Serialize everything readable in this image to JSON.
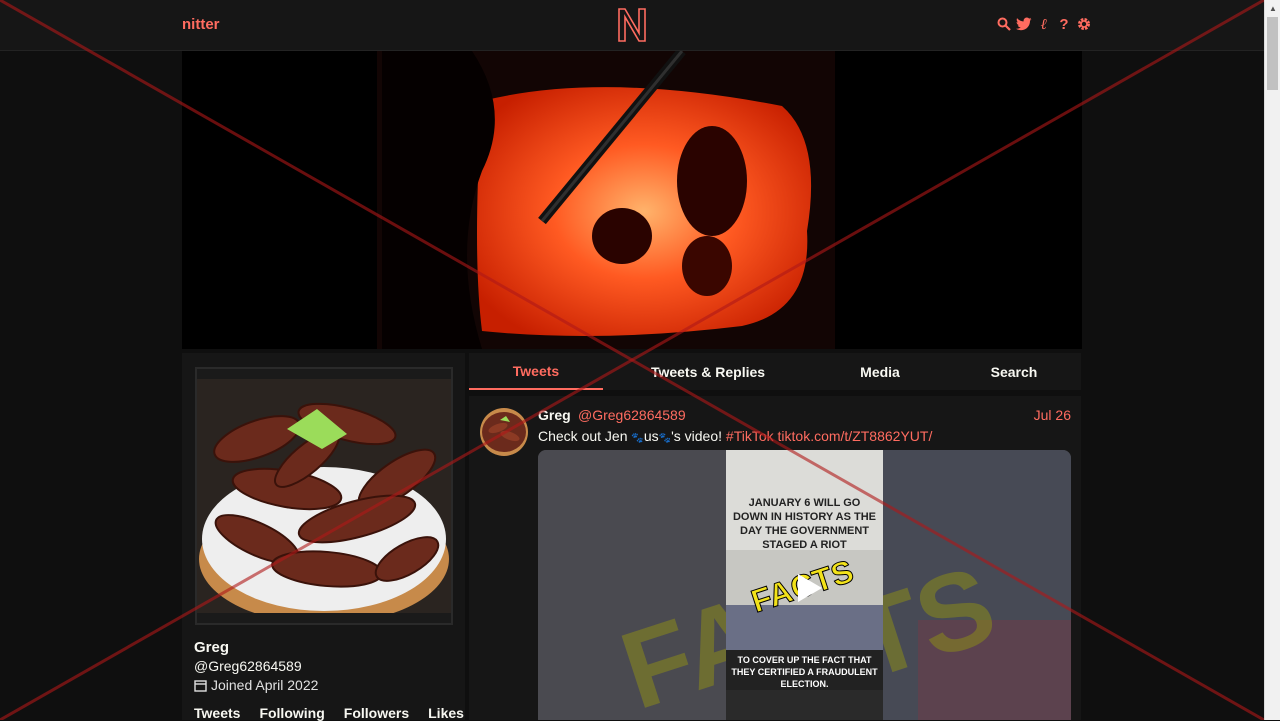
{
  "navbar": {
    "brand": "nitter",
    "logo_letter": "N",
    "icons": [
      "search-icon",
      "twitter-icon",
      "rss-icon",
      "help-icon",
      "gear-icon"
    ]
  },
  "banner": {
    "description_icon": "fire-banner-image"
  },
  "profile": {
    "name": "Greg",
    "handle": "@Greg62864589",
    "joined": "Joined April 2022",
    "stats": {
      "tweets": "Tweets",
      "following": "Following",
      "followers": "Followers",
      "likes": "Likes"
    }
  },
  "tabs": [
    {
      "label": "Tweets",
      "active": true
    },
    {
      "label": "Tweets & Replies",
      "active": false
    },
    {
      "label": "Media",
      "active": false
    },
    {
      "label": "Search",
      "active": false
    }
  ],
  "tweet": {
    "name": "Greg",
    "handle": "@Greg62864589",
    "date": "Jul 26",
    "text_before": "Check out Jen ",
    "text_mid": "us",
    "text_after": "'s video! ",
    "hashtag": "#TikTok",
    "link": "tiktok.com/t/ZT8862YUT/",
    "media_caption_top": "JANUARY 6 WILL GO DOWN IN HISTORY AS THE DAY THE GOVERNMENT STAGED A RIOT",
    "media_caption_bottom": "TO COVER UP THE FACT THAT THEY CERTIFIED A FRAUDULENT ELECTION.",
    "media_overlay_word": "FACTS"
  },
  "colors": {
    "accent": "#ff6c60",
    "background": "#0f0f0f",
    "panel": "#161616"
  }
}
